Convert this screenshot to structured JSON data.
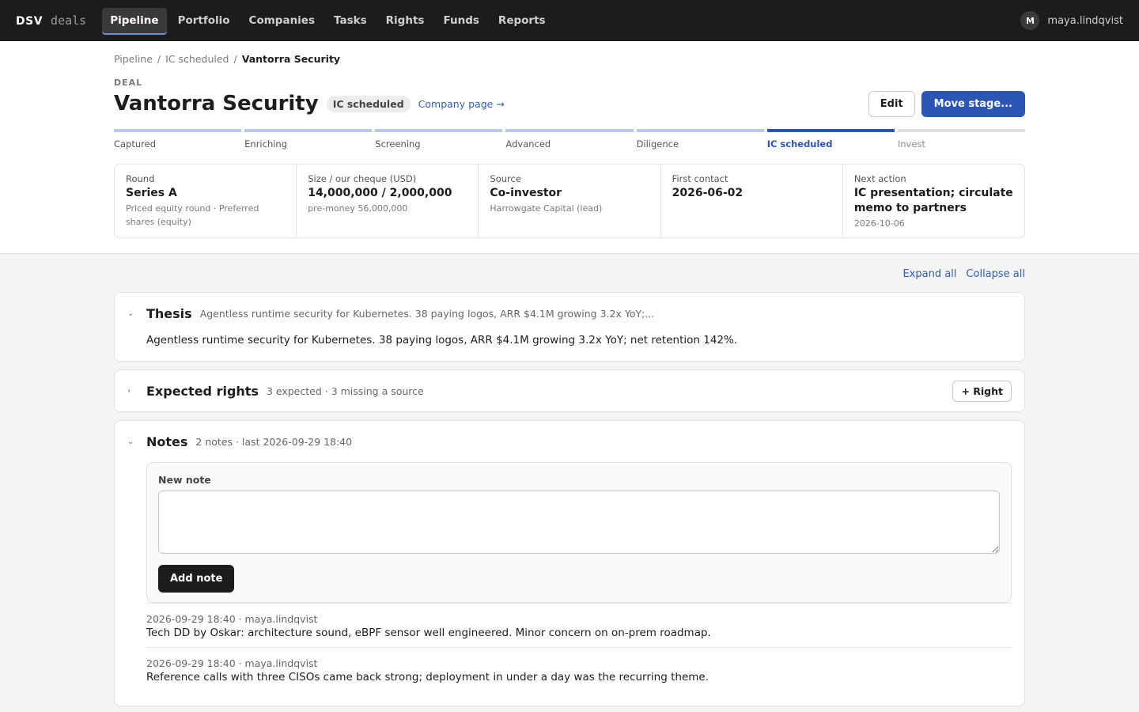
{
  "app": {
    "brand_a": "DSV",
    "brand_b": "deals"
  },
  "nav": [
    "Pipeline",
    "Portfolio",
    "Companies",
    "Tasks",
    "Rights",
    "Funds",
    "Reports"
  ],
  "user": {
    "initial": "M",
    "name": "maya.lindqvist"
  },
  "breadcrumb": {
    "c0": "Pipeline",
    "c1": "IC scheduled",
    "c2": "Vantorra Security"
  },
  "deal": {
    "eyebrow": "DEAL",
    "name": "Vantorra Security",
    "stage": "IC scheduled",
    "company_link": "Company page →",
    "edit": "Edit",
    "move": "Move stage..."
  },
  "stages": [
    "Captured",
    "Enriching",
    "Screening",
    "Advanced",
    "Diligence",
    "IC scheduled",
    "Invest"
  ],
  "facts": [
    {
      "k": "Round",
      "v": "Series A",
      "s": "Priced equity round · Preferred shares (equity)"
    },
    {
      "k": "Size / our cheque (USD)",
      "v": "14,000,000 / 2,000,000",
      "s": "pre-money 56,000,000"
    },
    {
      "k": "Source",
      "v": "Co-investor",
      "s": "Harrowgate Capital (lead)"
    },
    {
      "k": "First contact",
      "v": "2026-06-02",
      "s": ""
    },
    {
      "k": "Next action",
      "v": "IC presentation; circulate memo to partners",
      "s": "2026-10-06"
    }
  ],
  "tools": {
    "expand": "Expand all",
    "collapse": "Collapse all"
  },
  "thesis": {
    "title": "Thesis",
    "summary": "Agentless runtime security for Kubernetes. 38 paying logos, ARR $4.1M growing 3.2x YoY;...",
    "body": "Agentless runtime security for Kubernetes. 38 paying logos, ARR $4.1M growing 3.2x YoY; net retention 142%."
  },
  "rights": {
    "title": "Expected rights",
    "summary": "3 expected · 3 missing a source",
    "add": "+ Right"
  },
  "notes": {
    "title": "Notes",
    "summary": "2 notes · last 2026-09-29 18:40",
    "label": "New note",
    "add": "Add note",
    "items": [
      {
        "meta": "2026-09-29 18:40 · maya.lindqvist",
        "text": "Tech DD by Oskar: architecture sound, eBPF sensor well engineered. Minor concern on on-prem roadmap."
      },
      {
        "meta": "2026-09-29 18:40 · maya.lindqvist",
        "text": "Reference calls with three CISOs came back strong; deployment in under a day was the recurring theme."
      }
    ]
  }
}
